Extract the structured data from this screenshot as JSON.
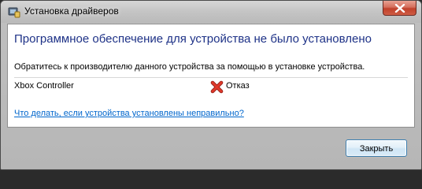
{
  "window": {
    "title": "Установка драйверов",
    "title_icon": "device-installer-icon",
    "close_icon": "close-icon"
  },
  "content": {
    "heading": "Программное обеспечение для устройства не было установлено",
    "instruction": "Обратитесь к производителю данного устройства за помощью в установке устройства.",
    "devices": [
      {
        "name": "Xbox Controller",
        "status_icon": "error-x-icon",
        "status": "Отказ"
      }
    ],
    "help_link": "Что делать, если устройства установлены неправильно?"
  },
  "footer": {
    "close_button": "Закрыть"
  },
  "colors": {
    "heading": "#1e3287",
    "link": "#0066cc",
    "error_icon": "#d42b1f"
  }
}
